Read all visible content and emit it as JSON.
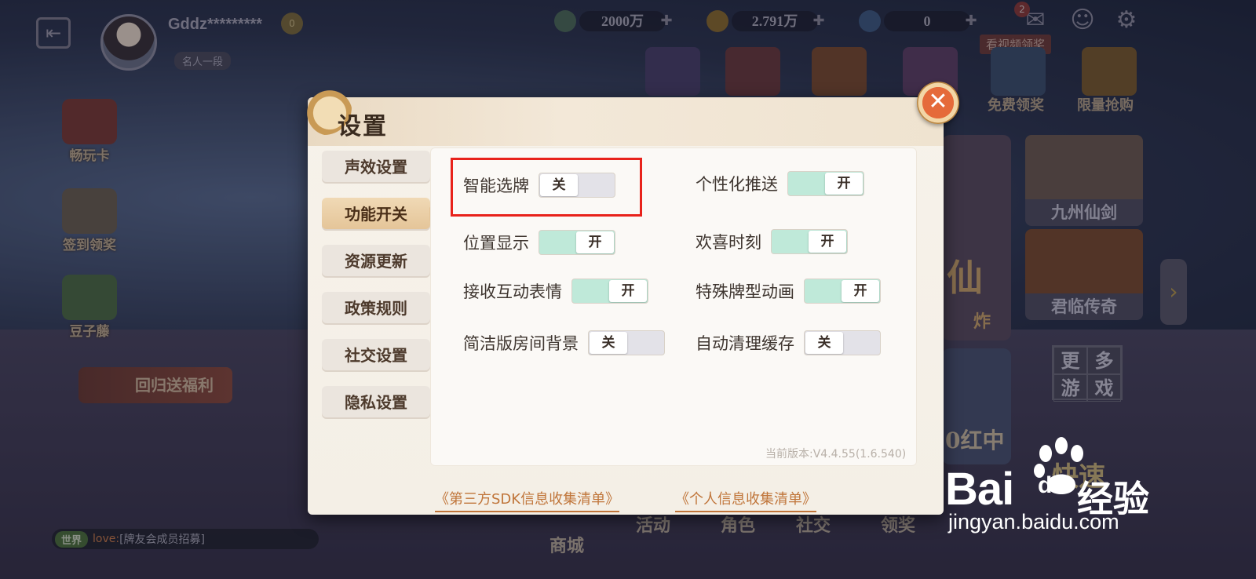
{
  "topbar": {
    "username": "Gddz*********",
    "rank_tag": "名人一段",
    "vip_level": "0",
    "beans": "2000万",
    "gold": "2.791万",
    "diamonds": "0",
    "mail_badge": "2",
    "video_banner": "看视频领奖"
  },
  "top_events": [
    {
      "label": "免费领奖"
    },
    {
      "label": "限量抢购"
    }
  ],
  "left_activities": [
    {
      "label": "畅玩卡"
    },
    {
      "label": "签到领奖"
    },
    {
      "label": "豆子藤"
    }
  ],
  "welfare_label": "回归送福利",
  "right_cards": [
    {
      "label": "九州仙剑"
    },
    {
      "label": "君临传奇"
    }
  ],
  "more_games": [
    "更",
    "多",
    "游",
    "戏"
  ],
  "tile_texts": {
    "xian": "仙",
    "zha": "炸",
    "hongzhong": "0红中",
    "kuai": "快速"
  },
  "bottom_nav": [
    "商城",
    "活动",
    "角色",
    "社交",
    "领奖"
  ],
  "chat": {
    "channel": "世界",
    "sender": "love:",
    "message": "[牌友会成员招募]"
  },
  "watermark": {
    "brand": "Bai",
    "brand_du": "du",
    "cn": "经验",
    "url": "jingyan.baidu.com"
  },
  "dialog": {
    "title": "设置",
    "close_symbol": "✕",
    "tabs": [
      {
        "label": "声效设置",
        "active": false
      },
      {
        "label": "功能开关",
        "active": true
      },
      {
        "label": "资源更新",
        "active": false
      },
      {
        "label": "政策规则",
        "active": false
      },
      {
        "label": "社交设置",
        "active": false
      },
      {
        "label": "隐私设置",
        "active": false
      }
    ],
    "settings": {
      "smart_select": {
        "label": "智能选牌",
        "state": "关"
      },
      "personal_push": {
        "label": "个性化推送",
        "state": "开"
      },
      "location_display": {
        "label": "位置显示",
        "state": "开"
      },
      "happy_moment": {
        "label": "欢喜时刻",
        "state": "开"
      },
      "receive_emotes": {
        "label": "接收互动表情",
        "state": "开"
      },
      "special_anim": {
        "label": "特殊牌型动画",
        "state": "开"
      },
      "simple_bg": {
        "label": "简洁版房间背景",
        "state": "关"
      },
      "auto_clear": {
        "label": "自动清理缓存",
        "state": "关"
      }
    },
    "version": "当前版本:V4.4.55(1.6.540)",
    "links": {
      "sdk_list": "《第三方SDK信息收集清单》",
      "personal_list": "《个人信息收集清单》"
    }
  },
  "colors": {
    "toggle_on": "#bfe9d9",
    "toggle_off": "#e3e2e8",
    "highlight": "#e8221b",
    "link": "#c0753a",
    "tab_active": "#e4c497"
  }
}
